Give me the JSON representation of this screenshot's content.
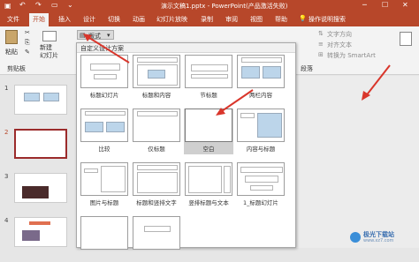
{
  "window": {
    "title": "演示文稿1.pptx - PowerPoint(产品激活失败)"
  },
  "tabs": [
    {
      "label": "文件"
    },
    {
      "label": "开始"
    },
    {
      "label": "插入"
    },
    {
      "label": "设计"
    },
    {
      "label": "切换"
    },
    {
      "label": "动画"
    },
    {
      "label": "幻灯片放映"
    },
    {
      "label": "录制"
    },
    {
      "label": "审阅"
    },
    {
      "label": "视图"
    },
    {
      "label": "帮助"
    },
    {
      "label": "操作说明搜索"
    }
  ],
  "ribbon": {
    "paste": "粘贴",
    "new_slide": "新建\n幻灯片",
    "layout_btn": "版式",
    "clipboard": "剪贴板",
    "text_direction": "文字方向",
    "align_text": "对齐文本",
    "smartart": "转换为 SmartArt",
    "paragraph": "段落"
  },
  "gallery": {
    "header": "自定义设计方案",
    "layouts": [
      {
        "label": "标题幻灯片"
      },
      {
        "label": "标题和内容"
      },
      {
        "label": "节标题"
      },
      {
        "label": "两栏内容"
      },
      {
        "label": "比较"
      },
      {
        "label": "仅标题"
      },
      {
        "label": "空白"
      },
      {
        "label": "内容与标题"
      },
      {
        "label": "图片与标题"
      },
      {
        "label": "标题和竖排文字"
      },
      {
        "label": "竖排标题与文本"
      },
      {
        "label": "1_标题幻灯片"
      }
    ]
  },
  "slides": [
    {
      "num": "1"
    },
    {
      "num": "2"
    },
    {
      "num": "3"
    },
    {
      "num": "4"
    }
  ],
  "watermark": {
    "text": "极光下载站",
    "url": "www.xz7.com"
  },
  "colors": {
    "accent": "#b7472a",
    "selection": "#9b2b2b",
    "arrow": "#d9362b"
  }
}
